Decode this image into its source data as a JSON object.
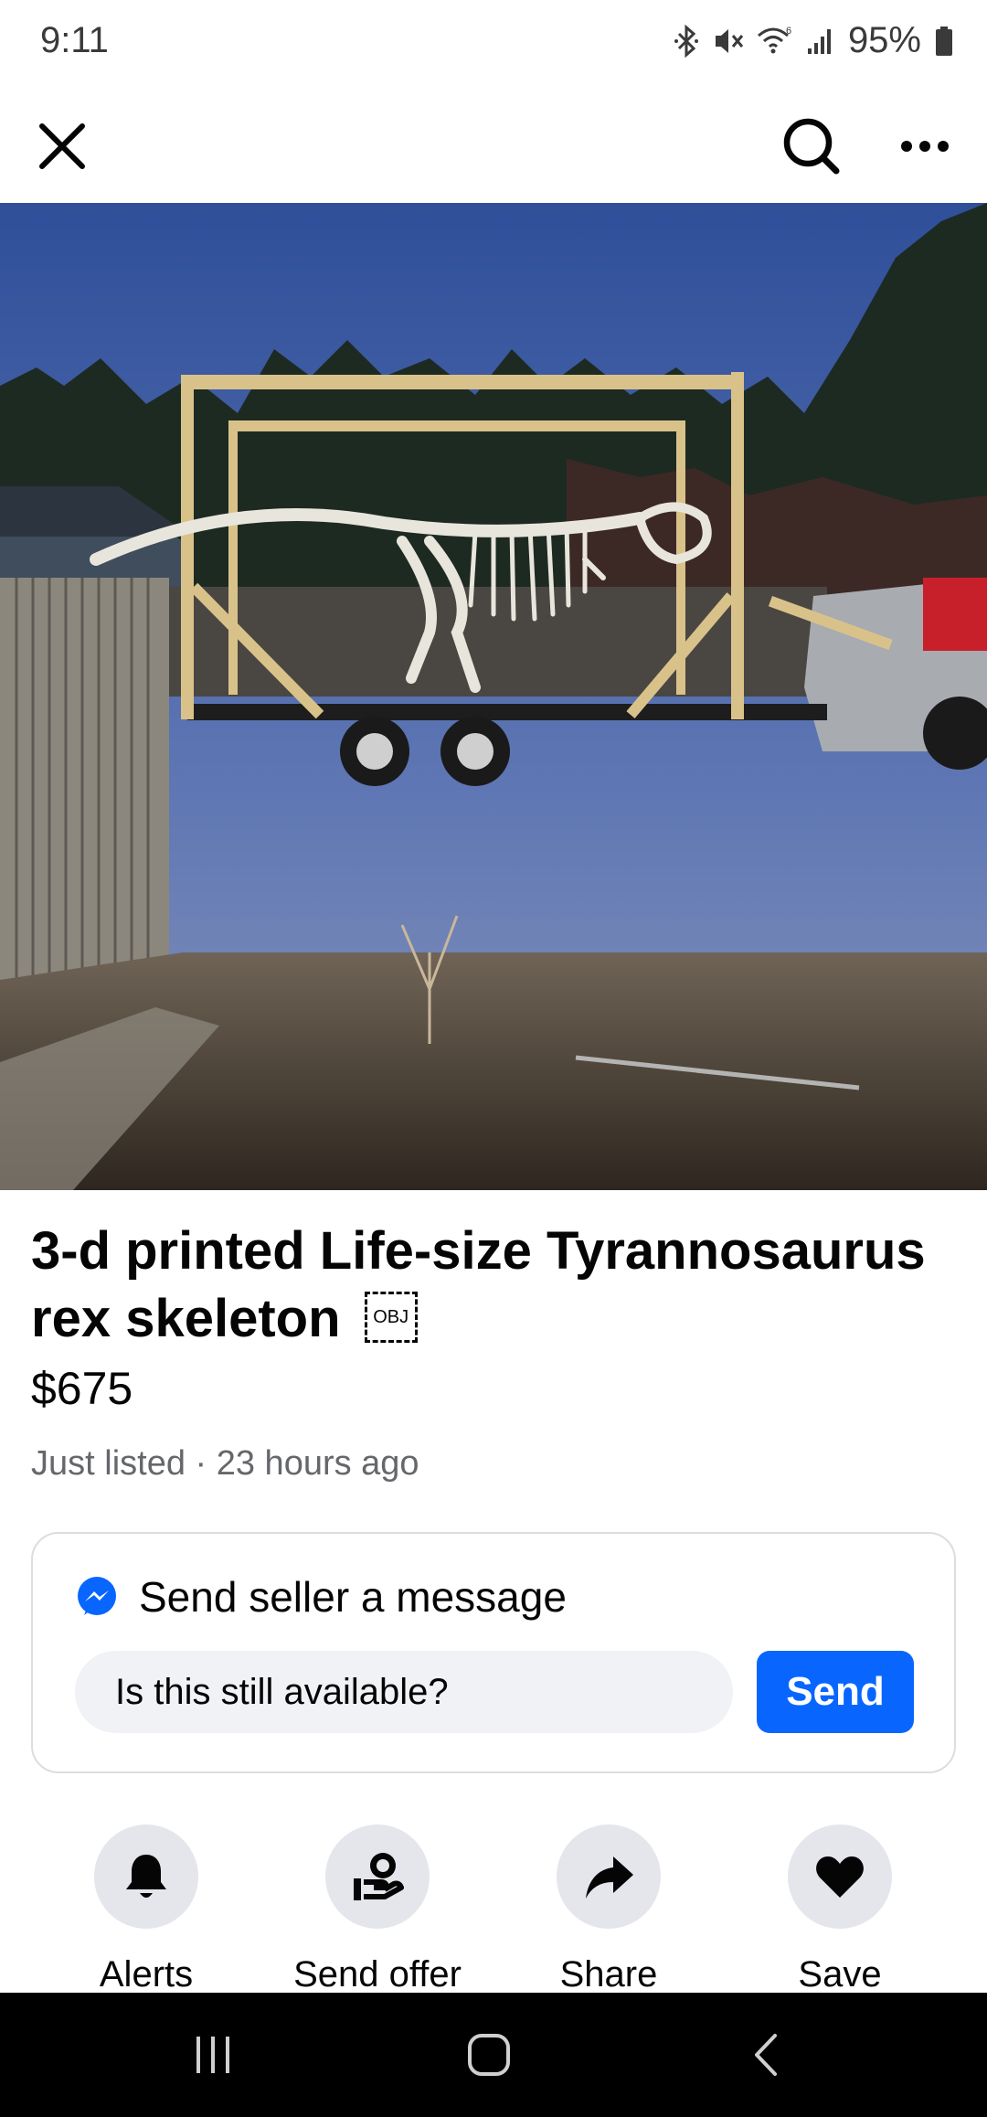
{
  "status_bar": {
    "time": "9:11",
    "battery": "95%",
    "icons": [
      "bluetooth-icon",
      "mute-icon",
      "wifi-icon",
      "signal-icon",
      "battery-icon"
    ]
  },
  "top_nav": {
    "icons": [
      "close-icon",
      "search-icon",
      "more-icon"
    ]
  },
  "photo": {
    "description_icon": "listing-photo",
    "carousel": {
      "count": 3,
      "active_index": 1
    }
  },
  "listing": {
    "title": "3-d printed Life-size Tyrannosaurus rex skeleton",
    "obj_glyph": "OBJ",
    "price": "$675",
    "listed": "Just listed · 23 hours ago"
  },
  "message": {
    "title": "Send seller a message",
    "input_value": "Is this still available?",
    "send_label": "Send"
  },
  "actions": [
    {
      "label": "Alerts",
      "icon": "bell-icon"
    },
    {
      "label": "Send offer",
      "icon": "offer-icon"
    },
    {
      "label": "Share",
      "icon": "share-icon"
    },
    {
      "label": "Save",
      "icon": "heart-icon"
    }
  ],
  "colors": {
    "accent": "#0866ff",
    "secondary_text": "#65676b",
    "action_circle": "#e4e6eb",
    "input_bg": "#f0f2f5"
  }
}
